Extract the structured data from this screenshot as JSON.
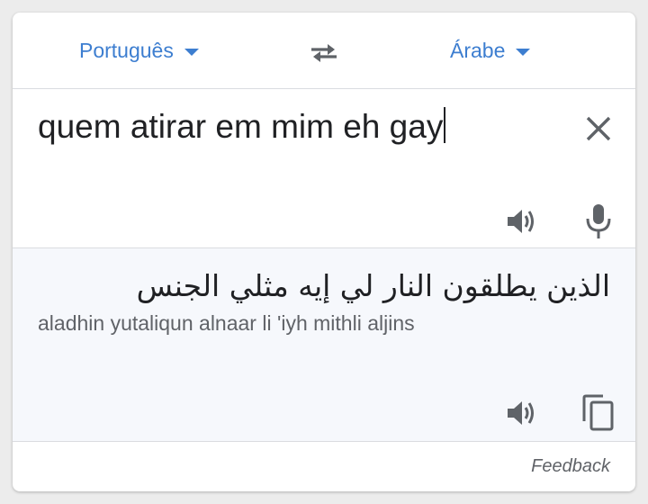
{
  "languages": {
    "source": "Português",
    "target": "Árabe"
  },
  "icons": {
    "swap": "swap-arrows-icon",
    "clear": "close-icon",
    "speaker": "speaker-icon",
    "mic": "microphone-icon",
    "copy": "copy-icon"
  },
  "input": {
    "text": "quem atirar em mim eh gay"
  },
  "output": {
    "translation": "الذين يطلقون النار لي إيه مثلي الجنس",
    "transliteration": "aladhin yutaliqun alnaar li 'iyh mithli aljins"
  },
  "footer": {
    "feedback_label": "Feedback"
  },
  "colors": {
    "accent": "#3d7ed0",
    "icon": "#5f6368",
    "output_bg": "#f6f8fc"
  }
}
